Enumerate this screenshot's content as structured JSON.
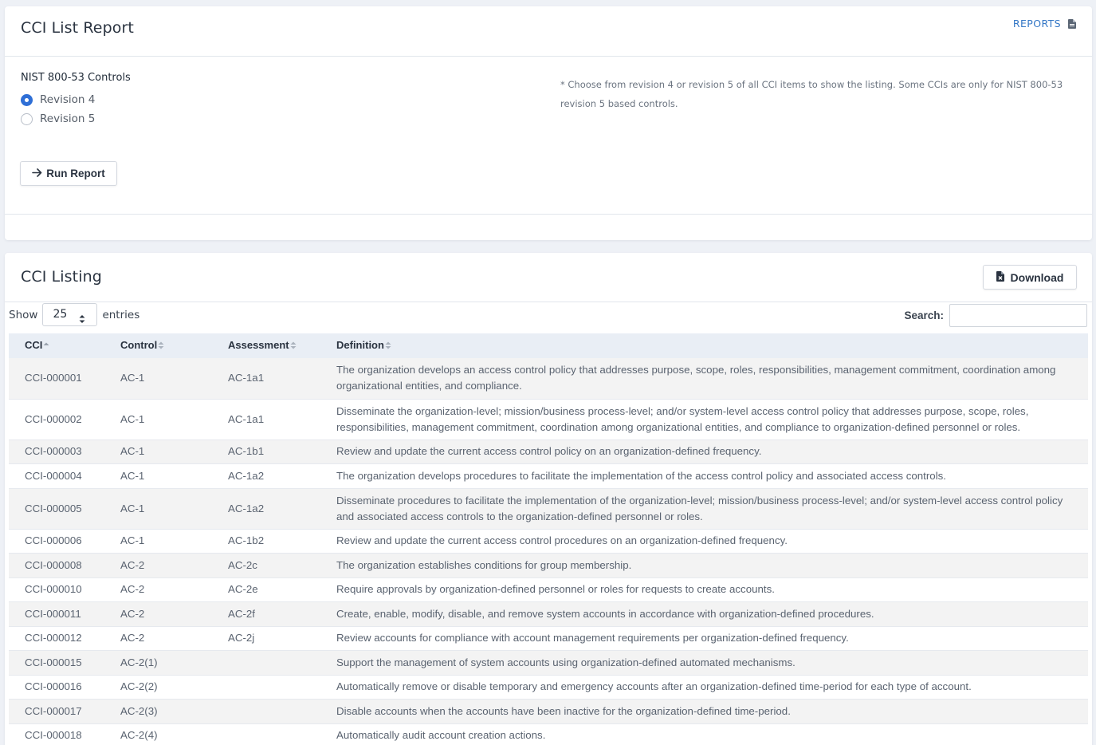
{
  "report_card": {
    "title": "CCI List Report",
    "reports_link": "REPORTS",
    "controls_label": "NIST 800-53 Controls",
    "options": [
      {
        "label": "Revision 4",
        "checked": true
      },
      {
        "label": "Revision 5",
        "checked": false
      }
    ],
    "note": "* Choose from revision 4 or revision 5 of all CCI items to show the listing. Some CCIs are only for NIST 800-53 revision 5 based controls.",
    "run_button": "Run Report",
    "run_icon": "arrow-right-icon"
  },
  "listing_card": {
    "title": "CCI Listing",
    "download_button": "Download",
    "download_icon": "excel-file-icon",
    "show_label": "Show",
    "entries_value": "25",
    "entries_label": "entries",
    "search_label": "Search:",
    "search_value": "",
    "columns": [
      "CCI",
      "Control",
      "Assessment",
      "Definition"
    ],
    "rows": [
      {
        "cci": "CCI-000001",
        "control": "AC-1",
        "assessment": "AC-1a1",
        "definition": "The organization develops an access control policy that addresses purpose, scope, roles, responsibilities, management commitment, coordination among organizational entities, and compliance."
      },
      {
        "cci": "CCI-000002",
        "control": "AC-1",
        "assessment": "AC-1a1",
        "definition": "Disseminate the organization-level; mission/business process-level; and/or system-level access control policy that addresses purpose, scope, roles, responsibilities, management commitment, coordination among organizational entities, and compliance to organization-defined personnel or roles."
      },
      {
        "cci": "CCI-000003",
        "control": "AC-1",
        "assessment": "AC-1b1",
        "definition": "Review and update the current access control policy on an organization-defined frequency."
      },
      {
        "cci": "CCI-000004",
        "control": "AC-1",
        "assessment": "AC-1a2",
        "definition": "The organization develops procedures to facilitate the implementation of the access control policy and associated access controls."
      },
      {
        "cci": "CCI-000005",
        "control": "AC-1",
        "assessment": "AC-1a2",
        "definition": "Disseminate procedures to facilitate the implementation of the organization-level; mission/business process-level; and/or system-level access control policy and associated access controls to the organization-defined personnel or roles."
      },
      {
        "cci": "CCI-000006",
        "control": "AC-1",
        "assessment": "AC-1b2",
        "definition": "Review and update the current access control procedures on an organization-defined frequency."
      },
      {
        "cci": "CCI-000008",
        "control": "AC-2",
        "assessment": "AC-2c",
        "definition": "The organization establishes conditions for group membership."
      },
      {
        "cci": "CCI-000010",
        "control": "AC-2",
        "assessment": "AC-2e",
        "definition": "Require approvals by organization-defined personnel or roles for requests to create accounts."
      },
      {
        "cci": "CCI-000011",
        "control": "AC-2",
        "assessment": "AC-2f",
        "definition": "Create, enable, modify, disable, and remove system accounts in accordance with organization-defined procedures."
      },
      {
        "cci": "CCI-000012",
        "control": "AC-2",
        "assessment": "AC-2j",
        "definition": "Review accounts for compliance with account management requirements per organization-defined frequency."
      },
      {
        "cci": "CCI-000015",
        "control": "AC-2(1)",
        "assessment": "",
        "definition": "Support the management of system accounts using organization-defined automated mechanisms."
      },
      {
        "cci": "CCI-000016",
        "control": "AC-2(2)",
        "assessment": "",
        "definition": "Automatically remove or disable temporary and emergency accounts after an organization-defined time-period for each type of account."
      },
      {
        "cci": "CCI-000017",
        "control": "AC-2(3)",
        "assessment": "",
        "definition": "Disable accounts when the accounts have been inactive for the organization-defined time-period."
      },
      {
        "cci": "CCI-000018",
        "control": "AC-2(4)",
        "assessment": "",
        "definition": "Automatically audit account creation actions."
      }
    ]
  },
  "colors": {
    "page_bg": "#eef1f6",
    "accent": "#3477c6",
    "radio_checked": "#2f6fd6",
    "table_header_bg": "#e9eef5",
    "row_striped": "#f3f3f3"
  }
}
